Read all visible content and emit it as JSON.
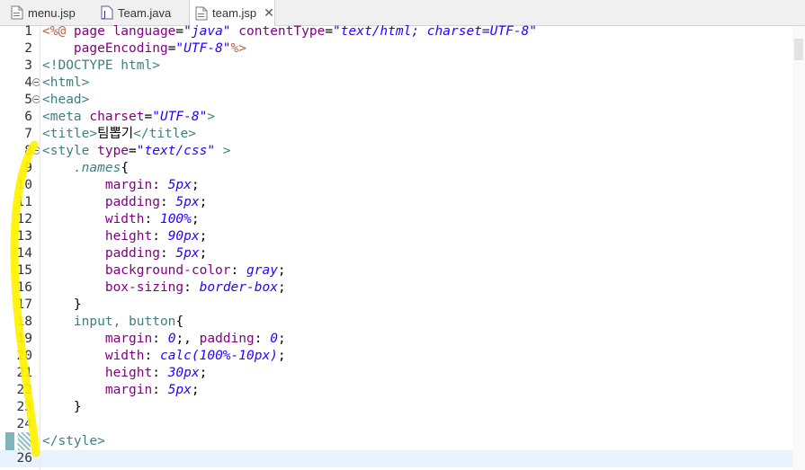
{
  "tabs": [
    {
      "label": "menu.jsp",
      "icon": "jsp-file-icon",
      "active": false
    },
    {
      "label": "Team.java",
      "icon": "java-file-icon",
      "active": false
    },
    {
      "label": "team.jsp",
      "icon": "jsp-file-icon",
      "active": true,
      "close": "✕"
    }
  ],
  "editor": {
    "line_numbers": [
      "1",
      "2",
      "3",
      "4",
      "5",
      "6",
      "7",
      "8",
      "9",
      "10",
      "11",
      "12",
      "13",
      "14",
      "15",
      "16",
      "17",
      "18",
      "19",
      "20",
      "21",
      "22",
      "23",
      "24",
      "25",
      "26"
    ],
    "current_line": 26,
    "highlight_color": "#fff200",
    "lines": [
      [
        [
          "dir",
          "<%@ "
        ],
        [
          "attr",
          "page "
        ],
        [
          "attr",
          "language"
        ],
        [
          "txt",
          "="
        ],
        [
          "str",
          "\"java\""
        ],
        [
          "txt",
          " "
        ],
        [
          "attr",
          "contentType"
        ],
        [
          "txt",
          "="
        ],
        [
          "str",
          "\"text/html; charset=UTF-8\""
        ]
      ],
      [
        [
          "txt",
          "    "
        ],
        [
          "attr",
          "pageEncoding"
        ],
        [
          "txt",
          "="
        ],
        [
          "str",
          "\"UTF-8\""
        ],
        [
          "dir",
          "%>"
        ]
      ],
      [
        [
          "tag",
          "<!DOCTYPE html>"
        ]
      ],
      [
        [
          "tag",
          "<html>"
        ]
      ],
      [
        [
          "tag",
          "<head>"
        ]
      ],
      [
        [
          "tag",
          "<meta "
        ],
        [
          "attr",
          "charset"
        ],
        [
          "txt",
          "="
        ],
        [
          "str",
          "\"UTF-8\""
        ],
        [
          "tag",
          ">"
        ]
      ],
      [
        [
          "tag",
          "<title>"
        ],
        [
          "txt",
          "팀뽑기"
        ],
        [
          "tag",
          "</title>"
        ]
      ],
      [
        [
          "tag",
          "<style "
        ],
        [
          "attr",
          "type"
        ],
        [
          "txt",
          "="
        ],
        [
          "str",
          "\"text/css\""
        ],
        [
          "tag",
          " >"
        ]
      ],
      [
        [
          "txt",
          "    "
        ],
        [
          "sel-i",
          ".names"
        ],
        [
          "txt",
          "{"
        ]
      ],
      [
        [
          "txt",
          "        "
        ],
        [
          "prop",
          "margin"
        ],
        [
          "txt",
          ": "
        ],
        [
          "cval",
          "5px"
        ],
        [
          "txt",
          ";"
        ]
      ],
      [
        [
          "txt",
          "        "
        ],
        [
          "prop",
          "padding"
        ],
        [
          "txt",
          ": "
        ],
        [
          "cval",
          "5px"
        ],
        [
          "txt",
          ";"
        ]
      ],
      [
        [
          "txt",
          "        "
        ],
        [
          "prop",
          "width"
        ],
        [
          "txt",
          ": "
        ],
        [
          "cval",
          "100%"
        ],
        [
          "txt",
          ";"
        ]
      ],
      [
        [
          "txt",
          "        "
        ],
        [
          "prop",
          "height"
        ],
        [
          "txt",
          ": "
        ],
        [
          "cval",
          "90px"
        ],
        [
          "txt",
          ";"
        ]
      ],
      [
        [
          "txt",
          "        "
        ],
        [
          "prop",
          "padding"
        ],
        [
          "txt",
          ": "
        ],
        [
          "cval",
          "5px"
        ],
        [
          "txt",
          ";"
        ]
      ],
      [
        [
          "txt",
          "        "
        ],
        [
          "prop",
          "background-color"
        ],
        [
          "txt",
          ": "
        ],
        [
          "cval",
          "gray"
        ],
        [
          "txt",
          ";"
        ]
      ],
      [
        [
          "txt",
          "        "
        ],
        [
          "prop",
          "box-sizing"
        ],
        [
          "txt",
          ": "
        ],
        [
          "cval",
          "border-box"
        ],
        [
          "txt",
          ";"
        ]
      ],
      [
        [
          "txt",
          "    }"
        ]
      ],
      [
        [
          "txt",
          "    "
        ],
        [
          "sel",
          "input, button"
        ],
        [
          "txt",
          "{"
        ]
      ],
      [
        [
          "txt",
          "        "
        ],
        [
          "prop",
          "margin"
        ],
        [
          "txt",
          ": "
        ],
        [
          "cval",
          "0"
        ],
        [
          "txt",
          ";, "
        ],
        [
          "prop",
          "padding"
        ],
        [
          "txt",
          ": "
        ],
        [
          "cval",
          "0"
        ],
        [
          "txt",
          ";"
        ]
      ],
      [
        [
          "txt",
          "        "
        ],
        [
          "prop",
          "width"
        ],
        [
          "txt",
          ": "
        ],
        [
          "cval",
          "calc(100%-10px)"
        ],
        [
          "txt",
          ";"
        ]
      ],
      [
        [
          "txt",
          "        "
        ],
        [
          "prop",
          "height"
        ],
        [
          "txt",
          ": "
        ],
        [
          "cval",
          "30px"
        ],
        [
          "txt",
          ";"
        ]
      ],
      [
        [
          "txt",
          "        "
        ],
        [
          "prop",
          "margin"
        ],
        [
          "txt",
          ": "
        ],
        [
          "cval",
          "5px"
        ],
        [
          "txt",
          ";"
        ]
      ],
      [
        [
          "txt",
          "    }"
        ]
      ],
      [
        [
          "txt",
          ""
        ]
      ],
      [
        [
          "tag",
          "</style>"
        ]
      ],
      [
        [
          "txt",
          ""
        ]
      ]
    ]
  }
}
